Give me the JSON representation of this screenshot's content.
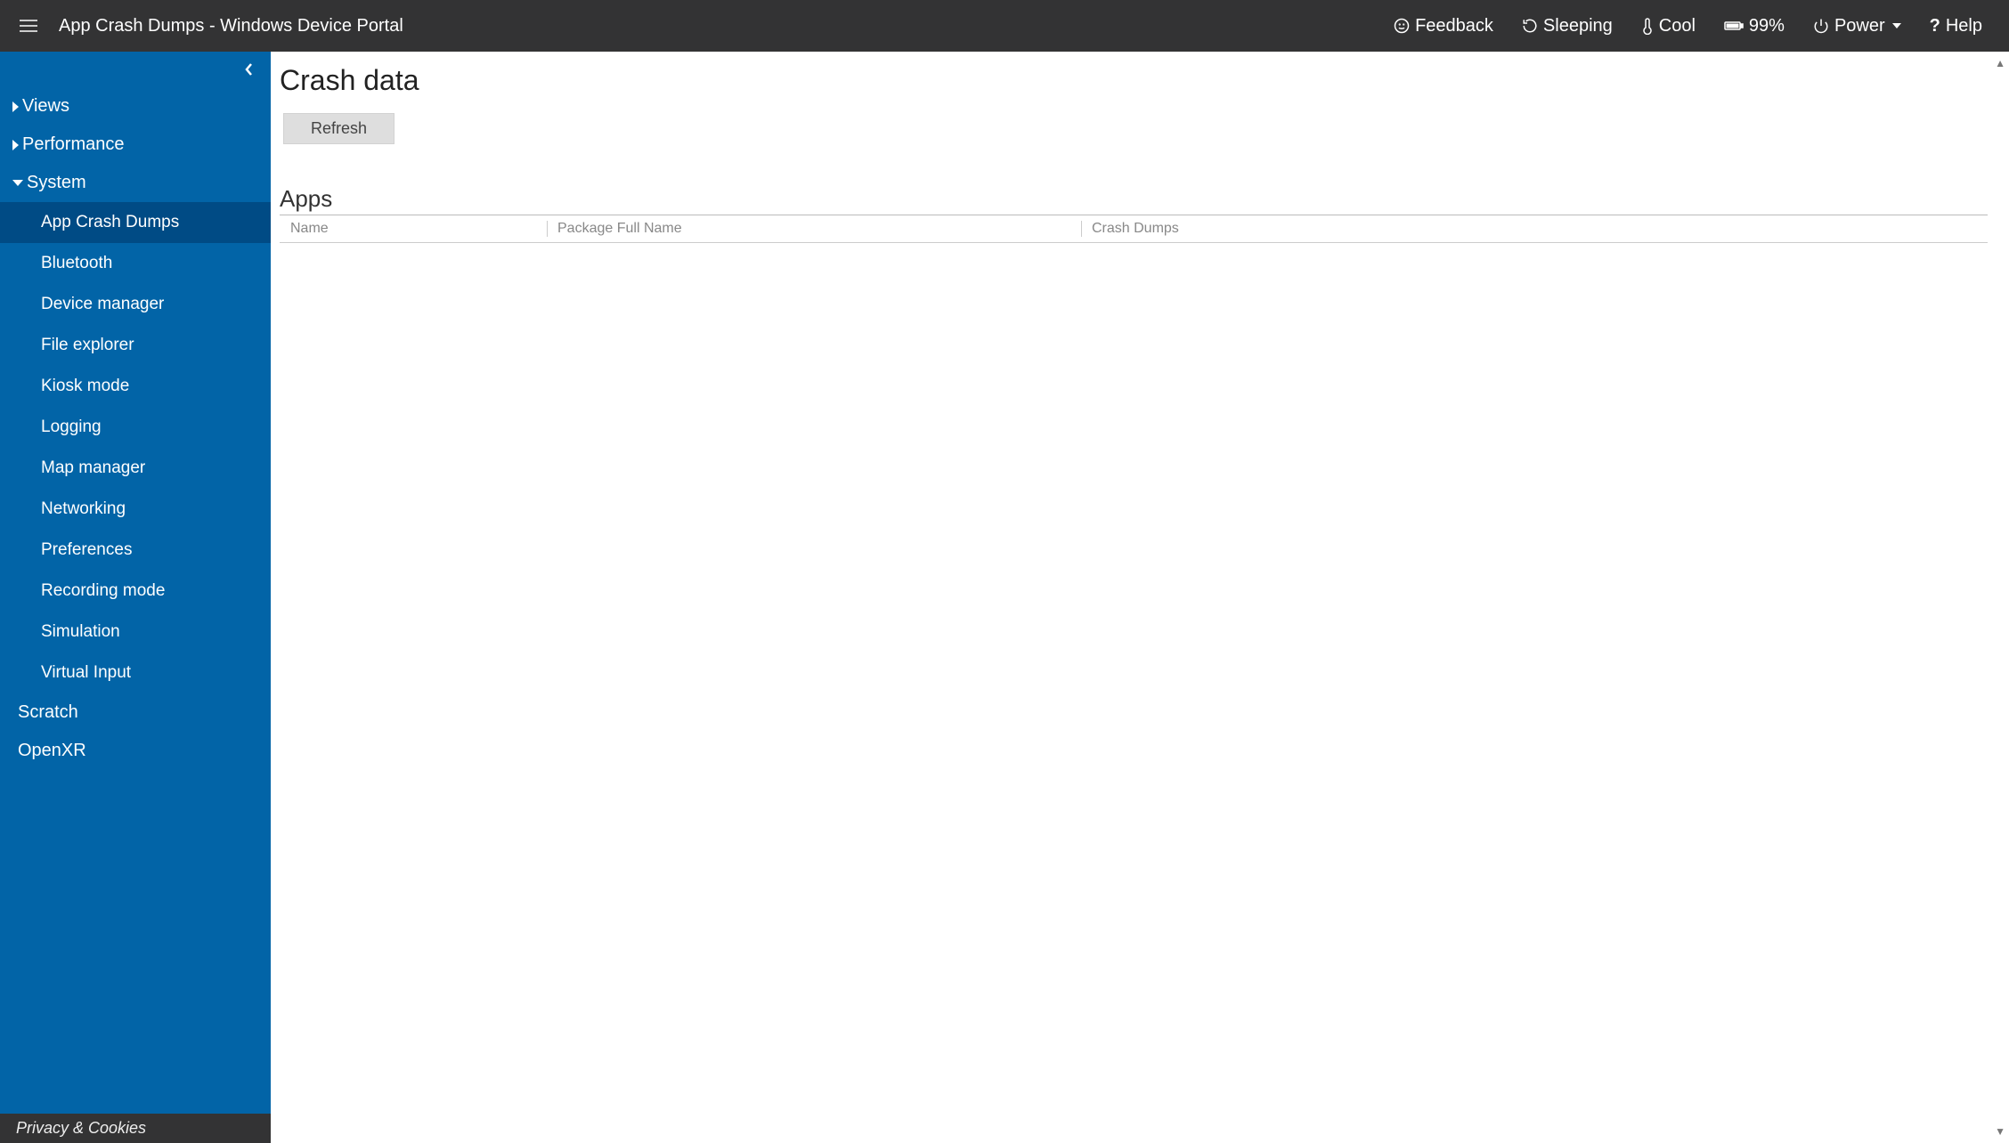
{
  "colors": {
    "accent": "#0264a7",
    "topbar": "#333334",
    "selected": "#004b85"
  },
  "topbar": {
    "title": "App Crash Dumps - Windows Device Portal",
    "feedback": "Feedback",
    "sleeping": "Sleeping",
    "cool": "Cool",
    "battery": "99%",
    "power": "Power",
    "help": "Help"
  },
  "sidebar": {
    "views": "Views",
    "performance": "Performance",
    "system": "System",
    "system_items": {
      "app_crash_dumps": "App Crash Dumps",
      "bluetooth": "Bluetooth",
      "device_manager": "Device manager",
      "file_explorer": "File explorer",
      "kiosk_mode": "Kiosk mode",
      "logging": "Logging",
      "map_manager": "Map manager",
      "networking": "Networking",
      "preferences": "Preferences",
      "recording_mode": "Recording mode",
      "simulation": "Simulation",
      "virtual_input": "Virtual Input"
    },
    "scratch": "Scratch",
    "openxr": "OpenXR",
    "footer": "Privacy & Cookies"
  },
  "main": {
    "page_title": "Crash data",
    "refresh": "Refresh",
    "apps_heading": "Apps",
    "columns": {
      "name": "Name",
      "package": "Package Full Name",
      "dumps": "Crash Dumps"
    },
    "rows": []
  }
}
